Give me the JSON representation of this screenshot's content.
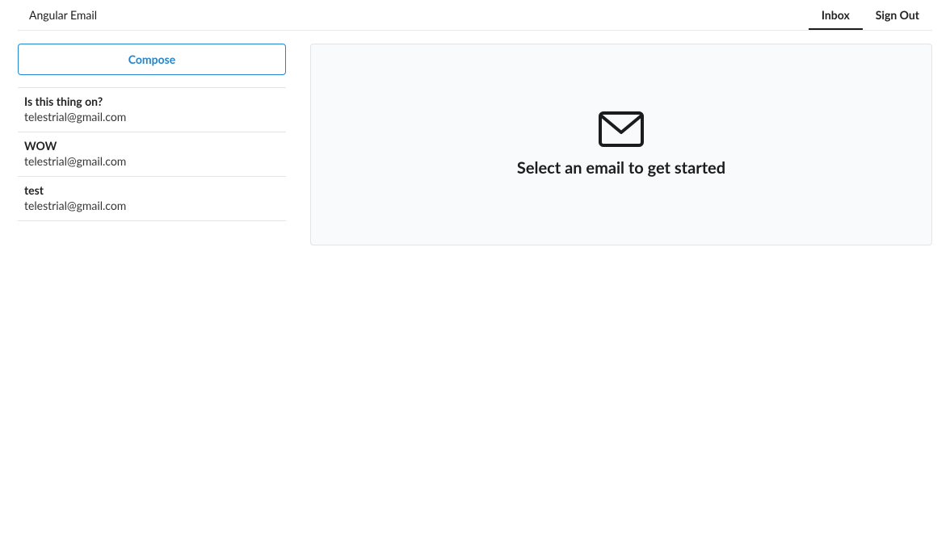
{
  "header": {
    "brand": "Angular Email",
    "nav": {
      "inbox": "Inbox",
      "signout": "Sign Out"
    }
  },
  "sidebar": {
    "compose_label": "Compose",
    "emails": [
      {
        "subject": "Is this thing on?",
        "from": "telestrial@gmail.com"
      },
      {
        "subject": "WOW",
        "from": "telestrial@gmail.com"
      },
      {
        "subject": "test",
        "from": "telestrial@gmail.com"
      }
    ]
  },
  "main": {
    "placeholder_message": "Select an email to get started"
  },
  "icons": {
    "envelope": "envelope-icon"
  },
  "colors": {
    "accent": "#2185d0",
    "border": "rgba(34,36,38,.12)",
    "panel_bg": "#f9fafb"
  }
}
